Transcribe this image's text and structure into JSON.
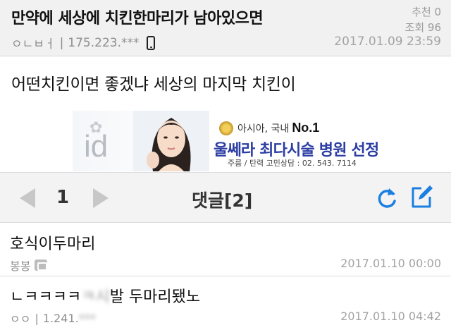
{
  "post": {
    "title": "만약에 세상에 치킨한마리가 남아있으면",
    "recommend": "추천 0",
    "views": "조회 96",
    "author": "ㅇㄴㅂㅓ",
    "ip": "175.223.***",
    "date": "2017.01.09 23:59",
    "body": "어떤치킨이면 좋겠냐 세상의 마지막 치킨이"
  },
  "ad": {
    "logo_text": "id",
    "tag": "아시아, 국내",
    "no1": "No.1",
    "headline": "울쎄라 최다시술 병원 선정",
    "contact": "주름 / 탄력 고민상담 : 02. 543. 7114"
  },
  "comment_bar": {
    "page": "1",
    "title": "댓글[2]"
  },
  "comments": [
    {
      "text": "호식이두마리",
      "author": "봉봉",
      "date": "2017.01.10 00:00"
    },
    {
      "text_visible": "ㄴㅋㅋㅋㅋ",
      "text_blurred": "ㅋ시",
      "text_rest": "발 두마리됐노",
      "author": "ㅇㅇ",
      "ip_visible": "1.241.",
      "ip_blurred": "***",
      "date": "2017.01.10 04:42"
    }
  ],
  "colors": {
    "accent_blue": "#1a7fe0",
    "meta_gray": "#8e8e8e",
    "header_bg": "#f1f1f1"
  },
  "icons": [
    "phone-icon",
    "badge-icon",
    "refresh-icon",
    "write-icon",
    "medal-icon"
  ]
}
